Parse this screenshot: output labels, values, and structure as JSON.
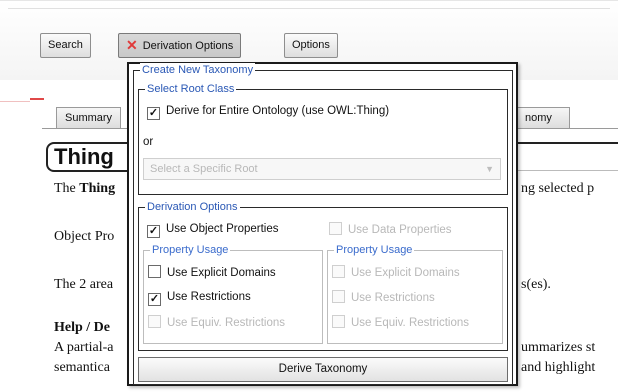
{
  "toolbar": {
    "search_label": "Search",
    "derivation_options_label": "Derivation Options",
    "options_label": "Options"
  },
  "tabs": [
    {
      "label": "Summary"
    },
    {
      "label": "nomy"
    }
  ],
  "page": {
    "title": "Thing",
    "line1_start": "The ",
    "line1_bold": "Thing",
    "line1_right": "ng selected p",
    "line2": "Object Pro",
    "line3_left": "The 2 area",
    "line3_right": "s(es).",
    "help_heading": "Help / De",
    "line4_left": "A partial-a",
    "line4_right": "ummarizes st",
    "line5_left": "semantica",
    "line5_right": "and highlight"
  },
  "dialog": {
    "create_legend": "Create New Taxonomy",
    "root_legend": "Select Root Class",
    "derive_entire": {
      "label": "Derive for Entire Ontology (use OWL:Thing)",
      "checked": true
    },
    "or_label": "or",
    "root_select_placeholder": "Select a Specific Root",
    "derivation_legend": "Derivation Options",
    "use_object_properties": {
      "label": "Use Object Properties",
      "checked": true
    },
    "use_data_properties": {
      "label": "Use Data Properties",
      "checked": false,
      "disabled": true
    },
    "object_usage": {
      "legend": "Property Usage",
      "explicit_domains": {
        "label": "Use Explicit Domains",
        "checked": false
      },
      "restrictions": {
        "label": "Use Restrictions",
        "checked": true
      },
      "equiv_restrictions": {
        "label": "Use Equiv. Restrictions",
        "checked": false,
        "disabled": true
      }
    },
    "data_usage": {
      "legend": "Property Usage",
      "explicit_domains": {
        "label": "Use Explicit Domains",
        "disabled": true
      },
      "restrictions": {
        "label": "Use Restrictions",
        "disabled": true
      },
      "equiv_restrictions": {
        "label": "Use Equiv. Restrictions",
        "disabled": true
      }
    },
    "derive_button": "Derive Taxonomy"
  },
  "colors": {
    "legend_blue": "#2a58b5",
    "disabled_text": "#b8b8b8",
    "x_icon_red": "#e03a3a"
  }
}
